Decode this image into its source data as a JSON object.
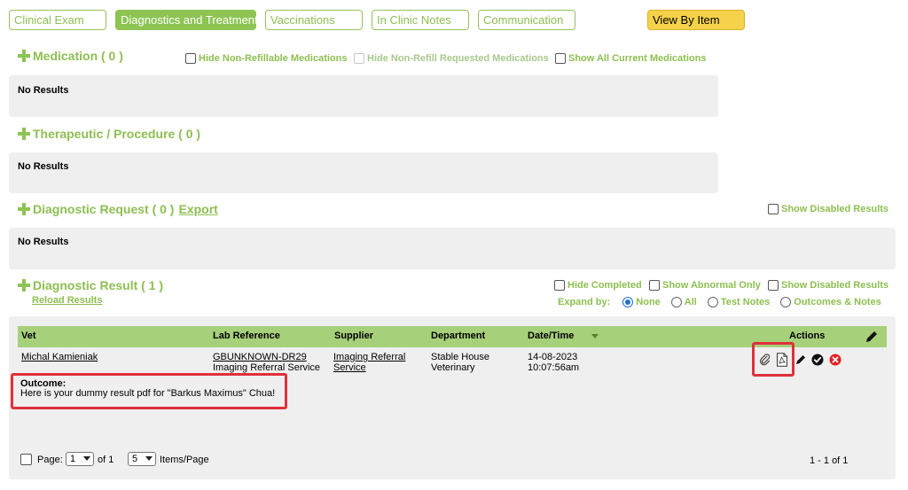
{
  "tabs": [
    {
      "label": "Clinical Exam"
    },
    {
      "label": "Diagnostics and Treatments"
    },
    {
      "label": "Vaccinations"
    },
    {
      "label": "In Clinic Notes"
    },
    {
      "label": "Communication"
    }
  ],
  "view_by_item": "View By Item",
  "medication": {
    "title": "Medication ( 0 )",
    "hide_non_refillable": "Hide Non-Refillable Medications",
    "hide_non_refill_requested": "Hide Non-Refill Requested Medications",
    "show_all_current": "Show All Current Medications",
    "no_results": "No Results"
  },
  "therapeutic": {
    "title": "Therapeutic / Procedure ( 0 )",
    "no_results": "No Results"
  },
  "diagnostic_request": {
    "title": "Diagnostic Request ( 0 )",
    "export": "Export",
    "show_disabled": "Show Disabled Results",
    "no_results": "No Results"
  },
  "diagnostic_result": {
    "title": "Diagnostic Result ( 1 )",
    "reload": "Reload Results",
    "hide_completed": "Hide Completed",
    "show_abnormal": "Show Abnormal Only",
    "show_disabled": "Show Disabled Results",
    "expand_by_label": "Expand by:",
    "expand_options": [
      "None",
      "All",
      "Test Notes",
      "Outcomes & Notes"
    ],
    "columns": {
      "vet": "Vet",
      "lab_reference": "Lab Reference",
      "supplier": "Supplier",
      "department": "Department",
      "date_time": "Date/Time",
      "actions": "Actions"
    },
    "row": {
      "vet": "Michal Kamieniak",
      "lab_ref": "GBUNKNOWN-DR29",
      "lab_ref_sub": "Imaging Referral Service",
      "supplier_line1": "Imaging Referral",
      "supplier_line2": "Service",
      "department_line1": "Stable House",
      "department_line2": "Veterinary",
      "date": "14-08-2023",
      "time": "10:07:56am"
    },
    "outcome_label": "Outcome:",
    "outcome_text": "Here is your dummy result pdf for \"Barkus Maximus\" Chua!",
    "pager": {
      "page_label": "Page:",
      "page_value": "1",
      "of_label": "of 1",
      "items_value": "5",
      "items_label": "Items/Page",
      "summary": "1 - 1 of 1"
    }
  },
  "colors": {
    "green": "#8dc452",
    "header_green": "#a7d07a",
    "yellow": "#f6d24a",
    "highlight_red": "#e0303b"
  }
}
